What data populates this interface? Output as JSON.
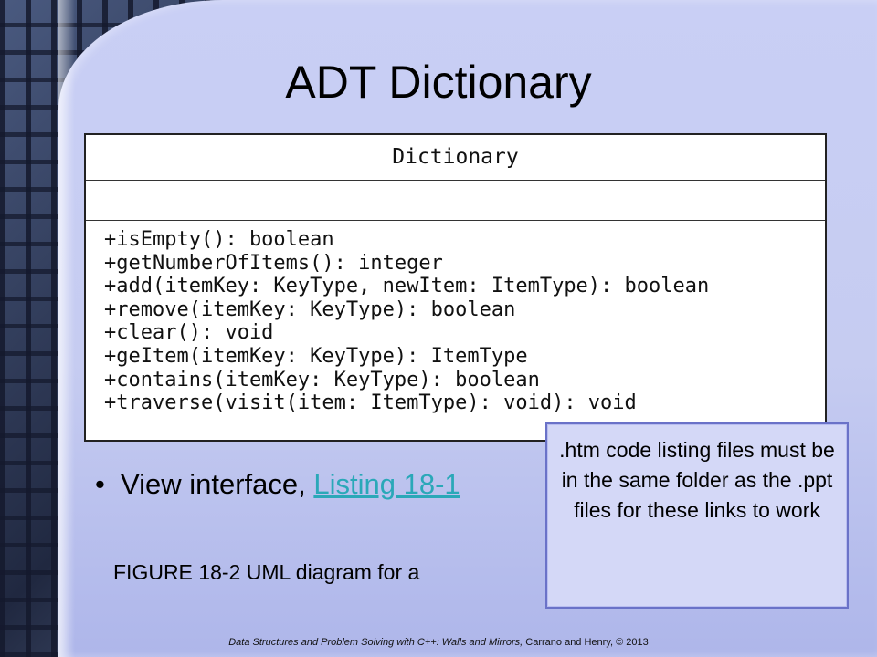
{
  "slide": {
    "title": "ADT Dictionary",
    "uml": {
      "class_name": "Dictionary",
      "operations": [
        "+isEmpty(): boolean",
        "+getNumberOfItems(): integer",
        "+add(itemKey: KeyType, newItem: ItemType): boolean",
        "+remove(itemKey: KeyType): boolean",
        "+clear(): void",
        "+geItem(itemKey: KeyType): ItemType",
        "+contains(itemKey: KeyType): boolean",
        "+traverse(visit(item: ItemType): void): void"
      ]
    },
    "bullet": {
      "symbol": "•",
      "text": "View interface, ",
      "link_label": "Listing 18-1"
    },
    "caption": "FIGURE 18-2 UML diagram for a",
    "note": ".htm code listing  files must be in the same folder as the .ppt files for these links to work",
    "footer": {
      "italic_text": "Data Structures and Problem Solving with C++: Walls and Mirrors,",
      "plain_text": " Carrano and Henry, © 2013"
    }
  },
  "colors": {
    "link": "#2aa8b8",
    "slide_background": "#c9cff5",
    "note_border": "#6a72c8"
  }
}
